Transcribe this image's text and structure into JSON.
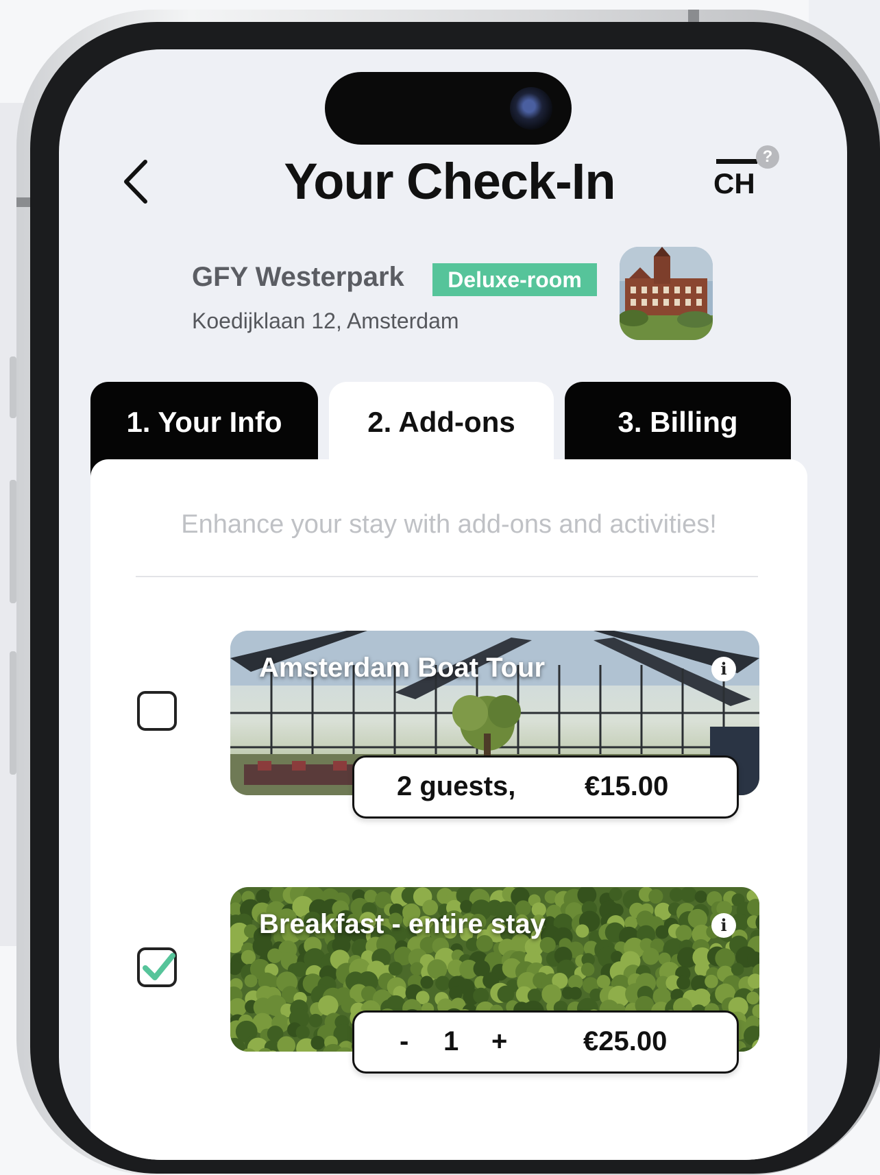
{
  "header": {
    "title": "Your Check-In",
    "brand": "CH",
    "help_glyph": "?",
    "back_icon": "chevron-left-icon"
  },
  "hotel": {
    "name": "GFY Westerpark",
    "room_badge": "Deluxe-room",
    "address": "Koedijklaan 12, Amsterdam"
  },
  "tabs": [
    {
      "label": "1. Your Info",
      "active": false
    },
    {
      "label": "2. Add-ons",
      "active": true
    },
    {
      "label": "3. Billing",
      "active": false
    }
  ],
  "addons_section": {
    "subtitle": "Enhance your stay with add-ons and activities!",
    "items": [
      {
        "title": "Amsterdam Boat Tour",
        "checked": false,
        "guests": "2 guests,",
        "price": "€15.00"
      },
      {
        "title": "Breakfast - entire stay",
        "checked": true,
        "minus": "-",
        "quantity": "1",
        "plus": "+",
        "price": "€25.00"
      }
    ]
  },
  "colors": {
    "accent_green": "#56c49a",
    "tab_dark": "#050505",
    "background": "#eef0f5"
  }
}
